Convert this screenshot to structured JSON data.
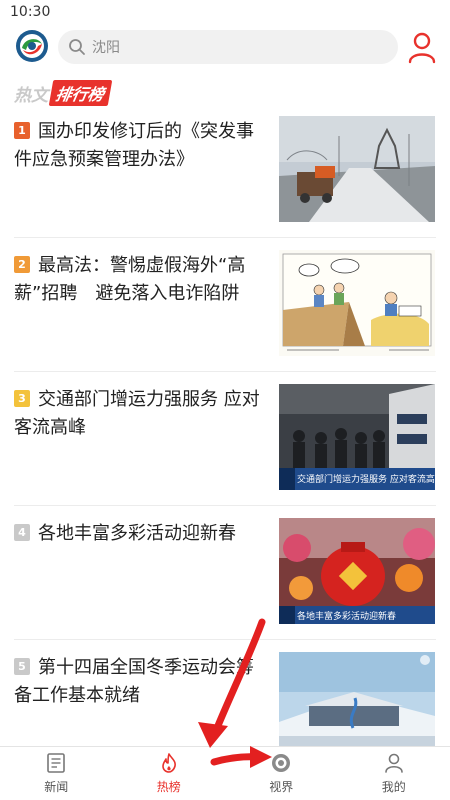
{
  "status": {
    "time": "10:30"
  },
  "search": {
    "placeholder": "沈阳"
  },
  "section": {
    "title_left": "热文",
    "title_right": "排行榜"
  },
  "news": [
    {
      "rank": "1",
      "rank_color": "#e8612c",
      "title": "国办印发修订后的《突发事件应急预案管理办法》",
      "thumb": "winter-road-photo"
    },
    {
      "rank": "2",
      "rank_color": "#f09a37",
      "title": "最高法：警惕虚假海外“高薪”招聘　避免落入电诈陷阱",
      "thumb": "cartoon-illustration"
    },
    {
      "rank": "3",
      "rank_color": "#f3c23b",
      "title": "交通部门增运力强服务 应对客流高峰",
      "thumb": "train-platform-photo",
      "caption": "交通部门增运力强服务 应对客流高峰"
    },
    {
      "rank": "4",
      "rank_color": "#c9c9c9",
      "title": "各地丰富多彩活动迎新春",
      "thumb": "spring-festival-photo",
      "caption": "各地丰富多彩活动迎新春"
    },
    {
      "rank": "5",
      "rank_color": "#c9c9c9",
      "title": "第十四届全国冬季运动会筹备工作基本就绪",
      "thumb": "winter-games-venue-photo"
    }
  ],
  "tabs": [
    {
      "label": "新闻",
      "icon": "newspaper-icon",
      "active": false
    },
    {
      "label": "热榜",
      "icon": "flame-icon",
      "active": true
    },
    {
      "label": "视界",
      "icon": "camera-lens-icon",
      "active": false
    },
    {
      "label": "我的",
      "icon": "person-icon",
      "active": false
    }
  ],
  "colors": {
    "accent": "#e8322c",
    "annotation_arrow": "#e32020"
  }
}
